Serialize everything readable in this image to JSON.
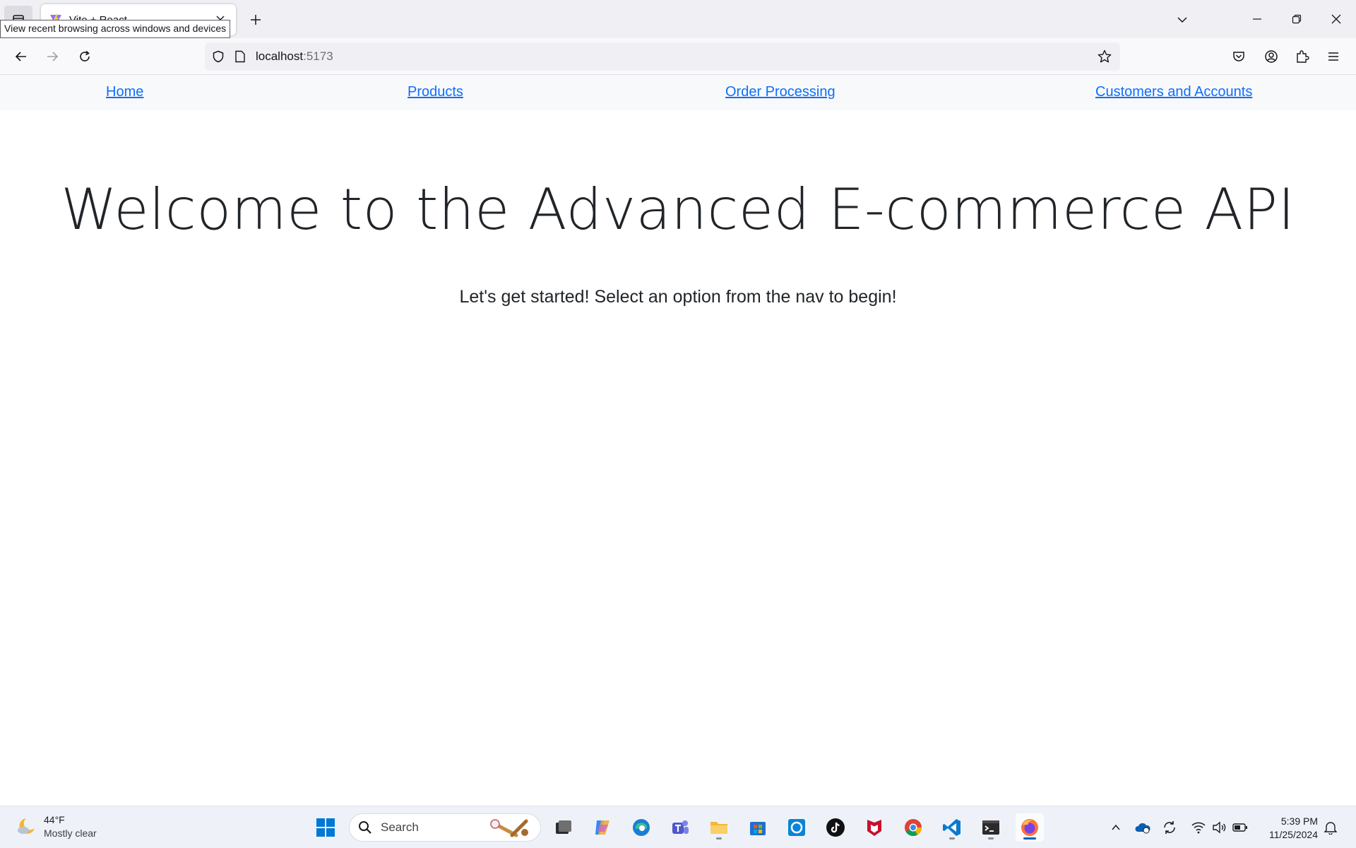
{
  "browser": {
    "tab_title": "Vite + React",
    "tooltip": "View recent browsing across windows and devices",
    "url_host": "localhost",
    "url_port": ":5173"
  },
  "site_nav": {
    "links": [
      "Home",
      "Products",
      "Order Processing",
      "Customers and Accounts"
    ]
  },
  "main": {
    "title": "Welcome to the Advanced E-commerce API",
    "subtitle": "Let's get started! Select an option from the nav to begin!"
  },
  "taskbar": {
    "weather_temp": "44°F",
    "weather_desc": "Mostly clear",
    "search_placeholder": "Search",
    "time": "5:39 PM",
    "date": "11/25/2024",
    "apps": [
      "start-icon",
      "search-icon",
      "task-view-icon",
      "copilot-icon",
      "edge-icon",
      "teams-icon",
      "file-explorer-icon",
      "store-icon",
      "app-icon",
      "tiktok-icon",
      "mcafee-icon",
      "chrome-icon",
      "vscode-icon",
      "terminal-icon",
      "firefox-icon"
    ]
  },
  "colors": {
    "link": "#0d6efd",
    "accent": "#005fb8"
  }
}
